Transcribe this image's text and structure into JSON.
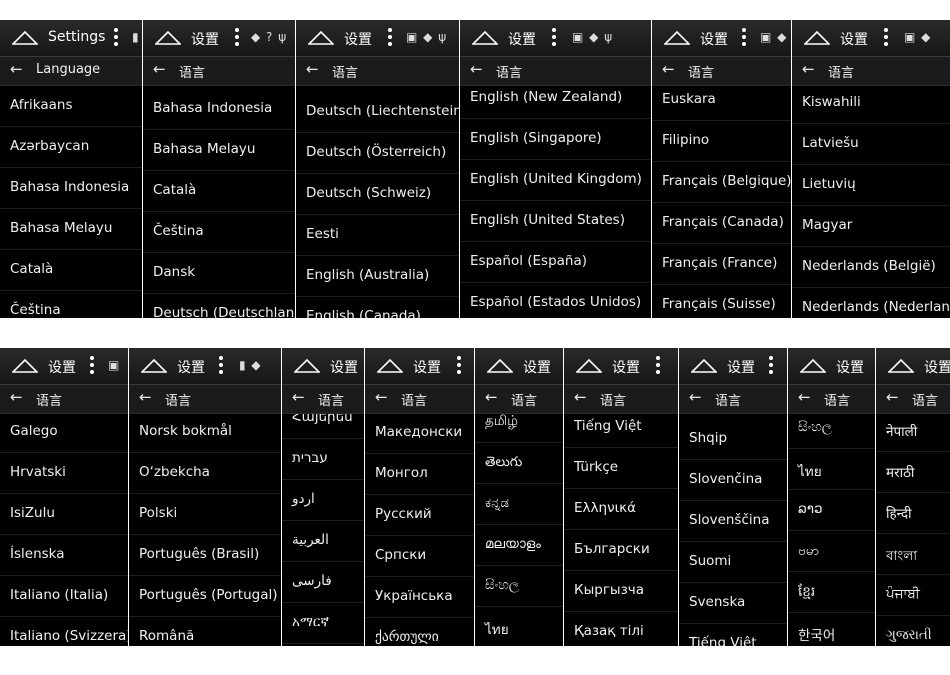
{
  "colors": {
    "panel_bg": "#000000",
    "statusbar_bg": "#1f1f1f",
    "appbar_bg": "#1b1b1d",
    "text": "#f0f0f0",
    "page_bg": "#ffffff"
  },
  "panels": [
    {
      "status_title": "Settings",
      "page_title": "Language",
      "status_icons": "▮",
      "items": [
        "Afrikaans",
        "Azərbaycan",
        "Bahasa Indonesia",
        "Bahasa Melayu",
        "Català",
        "Čeština"
      ]
    },
    {
      "status_title": "设置",
      "page_title": "语言",
      "status_icons": "◆ ? ψ",
      "items": [
        "Bahasa Indonesia",
        "Bahasa Melayu",
        "Català",
        "Čeština",
        "Dansk",
        "Deutsch (Deutschland)"
      ]
    },
    {
      "status_title": "设置",
      "page_title": "语言",
      "status_icons": "▣ ◆ ψ",
      "items": [
        "Deutsch (Liechtenstein)",
        "Deutsch (Österreich)",
        "Deutsch (Schweiz)",
        "Eesti",
        "English (Australia)",
        "English (Canada)"
      ]
    },
    {
      "status_title": "设置",
      "page_title": "语言",
      "status_icons": "▣ ◆ ψ",
      "items": [
        "English (New Zealand)",
        "English (Singapore)",
        "English (United Kingdom)",
        "English (United States)",
        "Español (España)",
        "Español (Estados Unidos)"
      ]
    },
    {
      "status_title": "设置",
      "page_title": "语言",
      "status_icons": "▣ ◆",
      "items": [
        "Euskara",
        "Filipino",
        "Français (Belgique)",
        "Français (Canada)",
        "Français (France)",
        "Français (Suisse)"
      ]
    },
    {
      "status_title": "设置",
      "page_title": "语言",
      "status_icons": "▣ ◆",
      "items": [
        "Kiswahili",
        "Latviešu",
        "Lietuvių",
        "Magyar",
        "Nederlands (België)",
        "Nederlands (Nederland)"
      ]
    },
    {
      "status_title": "设置",
      "page_title": "语言",
      "status_icons": "▣",
      "items": [
        "Galego",
        "Hrvatski",
        "IsiZulu",
        "Íslenska",
        "Italiano (Italia)",
        "Italiano (Svizzera)"
      ]
    },
    {
      "status_title": "设置",
      "page_title": "语言",
      "status_icons": "▮ ◆",
      "items": [
        "Norsk bokmål",
        "O‘zbekcha",
        "Polski",
        "Português (Brasil)",
        "Português (Portugal)",
        "Română"
      ]
    },
    {
      "status_title": "设置",
      "page_title": "语言",
      "status_icons": "",
      "items": [
        "Հայերեն",
        "עברית",
        "اردو",
        "العربية",
        "فارسی",
        "አማርኛ"
      ]
    },
    {
      "status_title": "设置",
      "page_title": "语言",
      "status_icons": "",
      "items": [
        "Македонски",
        "Монгол",
        "Русский",
        "Српски",
        "Українська",
        "ქართული"
      ]
    },
    {
      "status_title": "设置",
      "page_title": "语言",
      "status_icons": "",
      "items": [
        "தமிழ்",
        "తెలుగు",
        "ಕನ್ನಡ",
        "മലയാളം",
        "සිංහල",
        "ไทย"
      ]
    },
    {
      "status_title": "设置",
      "page_title": "语言",
      "status_icons": "",
      "items": [
        "Tiếng Việt",
        "Türkçe",
        "Ελληνικά",
        "Български",
        "Кыргызча",
        "Қазақ тілі"
      ]
    },
    {
      "status_title": "设置",
      "page_title": "语言",
      "status_icons": "",
      "items": [
        "Shqip",
        "Slovenčina",
        "Slovenščina",
        "Suomi",
        "Svenska",
        "Tiếng Việt"
      ]
    },
    {
      "status_title": "设置",
      "page_title": "语言",
      "status_icons": "",
      "items": [
        "සිංහල",
        "ไทย",
        "ລາວ",
        "ဗမာ",
        "ខ្មែរ",
        "한국어"
      ]
    },
    {
      "status_title": "设置",
      "page_title": "语言",
      "status_icons": "",
      "items": [
        "नेपाली",
        "मराठी",
        "हिन्दी",
        "বাংলা",
        "ਪੰਜਾਬੀ",
        "ગુજરાતી"
      ]
    }
  ]
}
